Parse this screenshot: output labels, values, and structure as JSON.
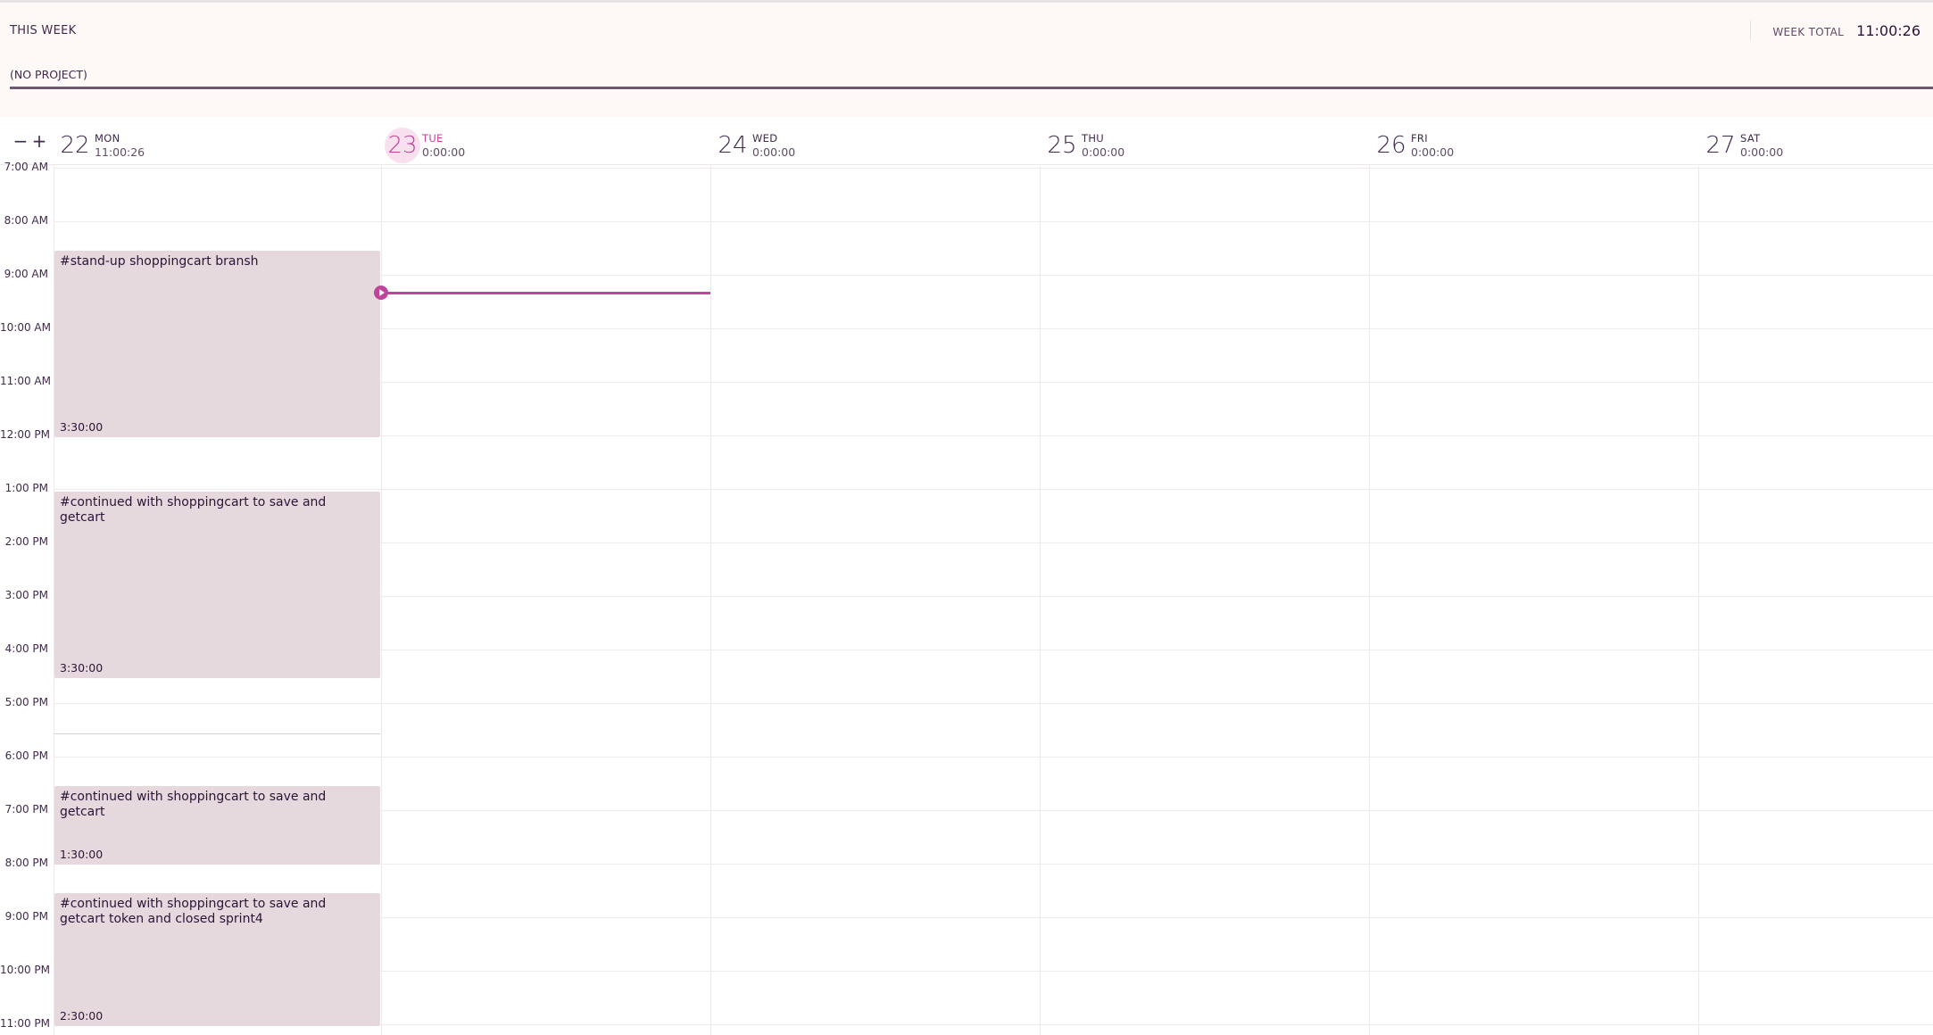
{
  "summary": {
    "period_label": "THIS WEEK",
    "week_total_label": "WEEK TOTAL",
    "week_total_value": "11:00:26",
    "project_label": "(NO PROJECT)"
  },
  "zoom": {
    "minus": "−",
    "plus": "+"
  },
  "days": [
    {
      "num": "22",
      "name": "MON",
      "duration": "11:00:26",
      "today": false
    },
    {
      "num": "23",
      "name": "TUE",
      "duration": "0:00:00",
      "today": true
    },
    {
      "num": "24",
      "name": "WED",
      "duration": "0:00:00",
      "today": false
    },
    {
      "num": "25",
      "name": "THU",
      "duration": "0:00:00",
      "today": false
    },
    {
      "num": "26",
      "name": "FRI",
      "duration": "0:00:00",
      "today": false
    },
    {
      "num": "27",
      "name": "SAT",
      "duration": "0:00:00",
      "today": false
    }
  ],
  "times": [
    "7:00 AM",
    "8:00 AM",
    "9:00 AM",
    "10:00 AM",
    "11:00 AM",
    "12:00 PM",
    "1:00 PM",
    "2:00 PM",
    "3:00 PM",
    "4:00 PM",
    "5:00 PM",
    "6:00 PM",
    "7:00 PM",
    "8:00 PM",
    "9:00 PM",
    "10:00 PM",
    "11:00 PM"
  ],
  "entries": [
    {
      "title": "#stand-up shoppingcart bransh",
      "duration": "3:30:00"
    },
    {
      "title": "#continued with shoppingcart to save and getcart",
      "duration": "3:30:00"
    },
    {
      "title": "#continued with shoppingcart to save and getcart",
      "duration": "1:30:00"
    },
    {
      "title": "#continued with shoppingcart to save and getcart token and closed sprint4",
      "duration": "2:30:00"
    }
  ],
  "colors": {
    "accent": "#c1449a",
    "entry_bg": "#e5d9dd",
    "header_bg": "#fef8f6",
    "project_bar": "#6e5970"
  }
}
